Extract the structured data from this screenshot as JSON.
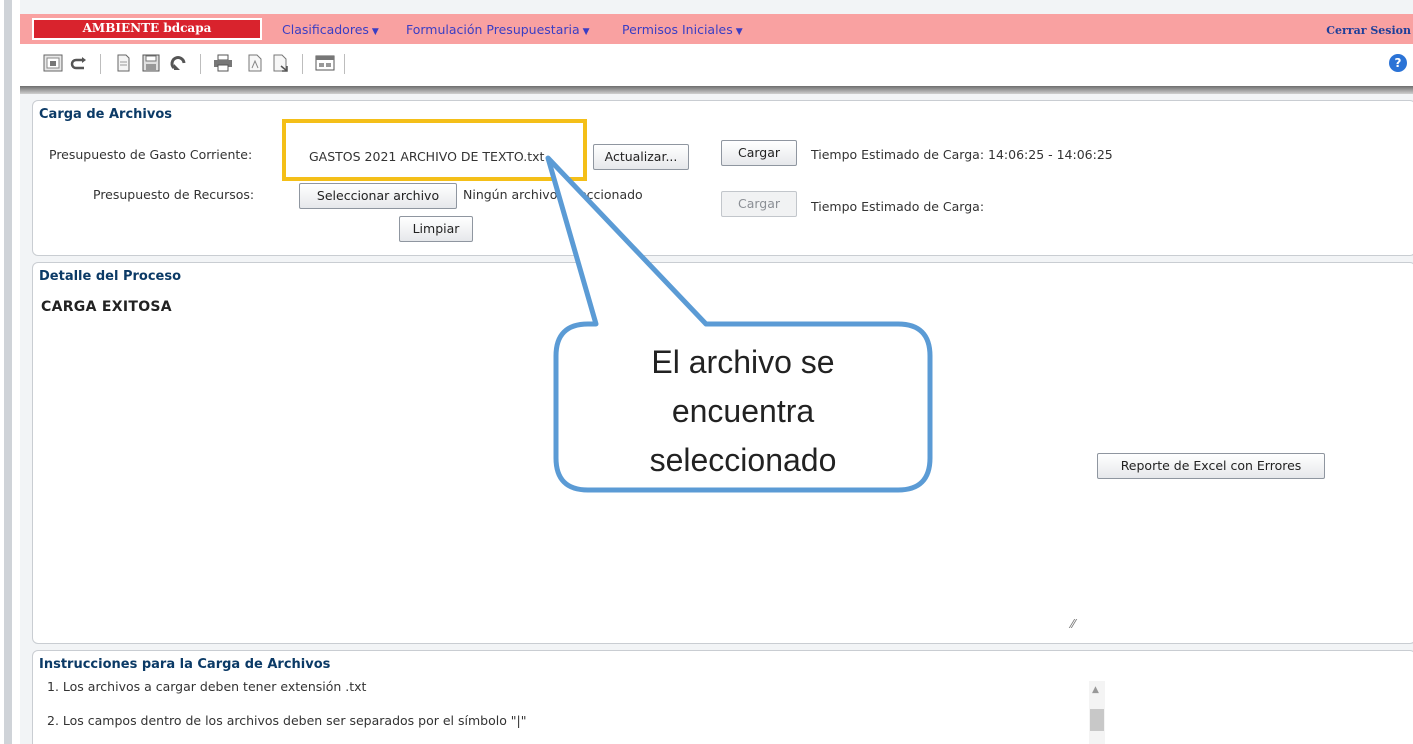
{
  "menubar": {
    "environment": "AMBIENTE bdcapa",
    "menus": [
      "Clasificadores",
      "Formulación Presupuestaria",
      "Permisos Iniciales"
    ],
    "logout": "Cerrar Sesion"
  },
  "toolbar": {
    "icons": [
      "query-icon",
      "undo-icon",
      "new-document-icon",
      "save-icon",
      "refresh-icon",
      "print-icon",
      "pdf-icon",
      "export-icon",
      "window-icon",
      "help-icon"
    ]
  },
  "carga": {
    "title": "Carga de Archivos",
    "gasto_label": "Presupuesto de Gasto Corriente:",
    "gasto_file": "GASTOS 2021 ARCHIVO DE TEXTO.txt",
    "actualizar": "Actualizar...",
    "cargar1": "Cargar",
    "tiempo1": "Tiempo Estimado de Carga:  14:06:25 - 14:06:25",
    "recursos_label": "Presupuesto de Recursos:",
    "seleccionar": "Seleccionar archivo",
    "ningun": "Ningún archivo seleccionado",
    "cargar2": "Cargar",
    "tiempo2": "Tiempo Estimado de Carga:",
    "limpiar": "Limpiar"
  },
  "detalle": {
    "title": "Detalle del Proceso",
    "result": "CARGA EXITOSA",
    "reporte": "Reporte de Excel con Errores"
  },
  "callout": {
    "lines": [
      "El archivo se",
      "encuentra",
      "seleccionado"
    ]
  },
  "instrucciones": {
    "title": "Instrucciones para la Carga de Archivos",
    "items": [
      "1. Los archivos a cargar deben tener extensión .txt",
      "2. Los campos dentro de los archivos deben ser separados por el símbolo \"|\""
    ]
  },
  "colors": {
    "menubar": "#f9a1a1",
    "badge": "#d9232d",
    "highlight": "#f4bf18",
    "callout_border": "#5b9bd5",
    "panel_title": "#0b3a66"
  }
}
